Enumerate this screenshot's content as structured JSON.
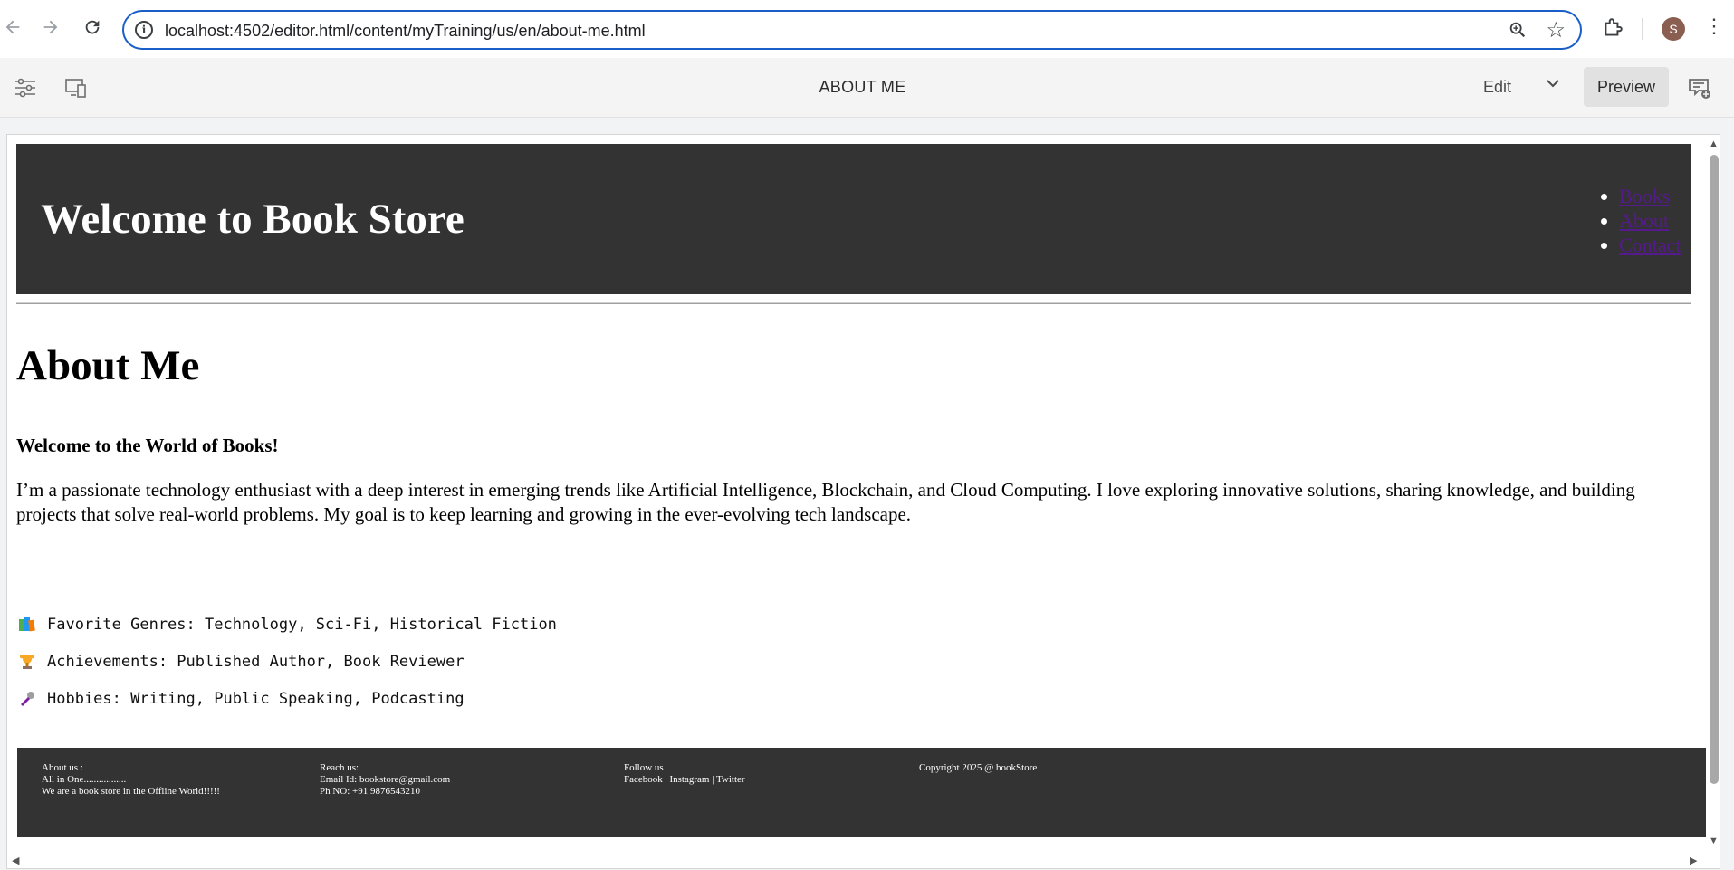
{
  "browser": {
    "url": "localhost:4502/editor.html/content/myTraining/us/en/about-me.html",
    "avatar_initial": "S"
  },
  "editor": {
    "page_title": "ABOUT ME",
    "mode_label": "Edit",
    "preview_label": "Preview"
  },
  "site": {
    "header_title": "Welcome to Book Store",
    "nav": [
      "Books",
      "About",
      "Contact"
    ],
    "page_heading": "About Me",
    "welcome": "Welcome to the World of Books!",
    "bio": "I’m a passionate technology enthusiast with a deep interest in emerging trends like Artificial Intelligence, Blockchain, and Cloud Computing. I love exploring innovative solutions, sharing knowledge, and building projects that solve real-world problems. My goal is to keep learning and growing in the ever-evolving tech landscape.",
    "facts": [
      {
        "icon": "books-icon",
        "text": "Favorite Genres: Technology, Sci-Fi, Historical Fiction"
      },
      {
        "icon": "trophy-icon",
        "text": "Achievements: Published Author, Book Reviewer"
      },
      {
        "icon": "microphone-icon",
        "text": "Hobbies: Writing, Public Speaking, Podcasting"
      }
    ],
    "footer": {
      "about": {
        "title": "About  us :",
        "line1": "All in One.................",
        "line2": "We are a book store in the Offline World!!!!!"
      },
      "reach": {
        "title": "Reach  us:",
        "email": "Email Id:  bookstore@gmail.com",
        "phone": "Ph NO: +91 9876543210"
      },
      "follow": {
        "title": "Follow us",
        "links": "Facebook | Instagram | Twitter"
      },
      "copyright": "Copyright 2025 @ bookStore"
    }
  },
  "colors": {
    "accent": "#1a5fc7",
    "header_bg": "#333333",
    "link_visited": "#551a8b"
  }
}
